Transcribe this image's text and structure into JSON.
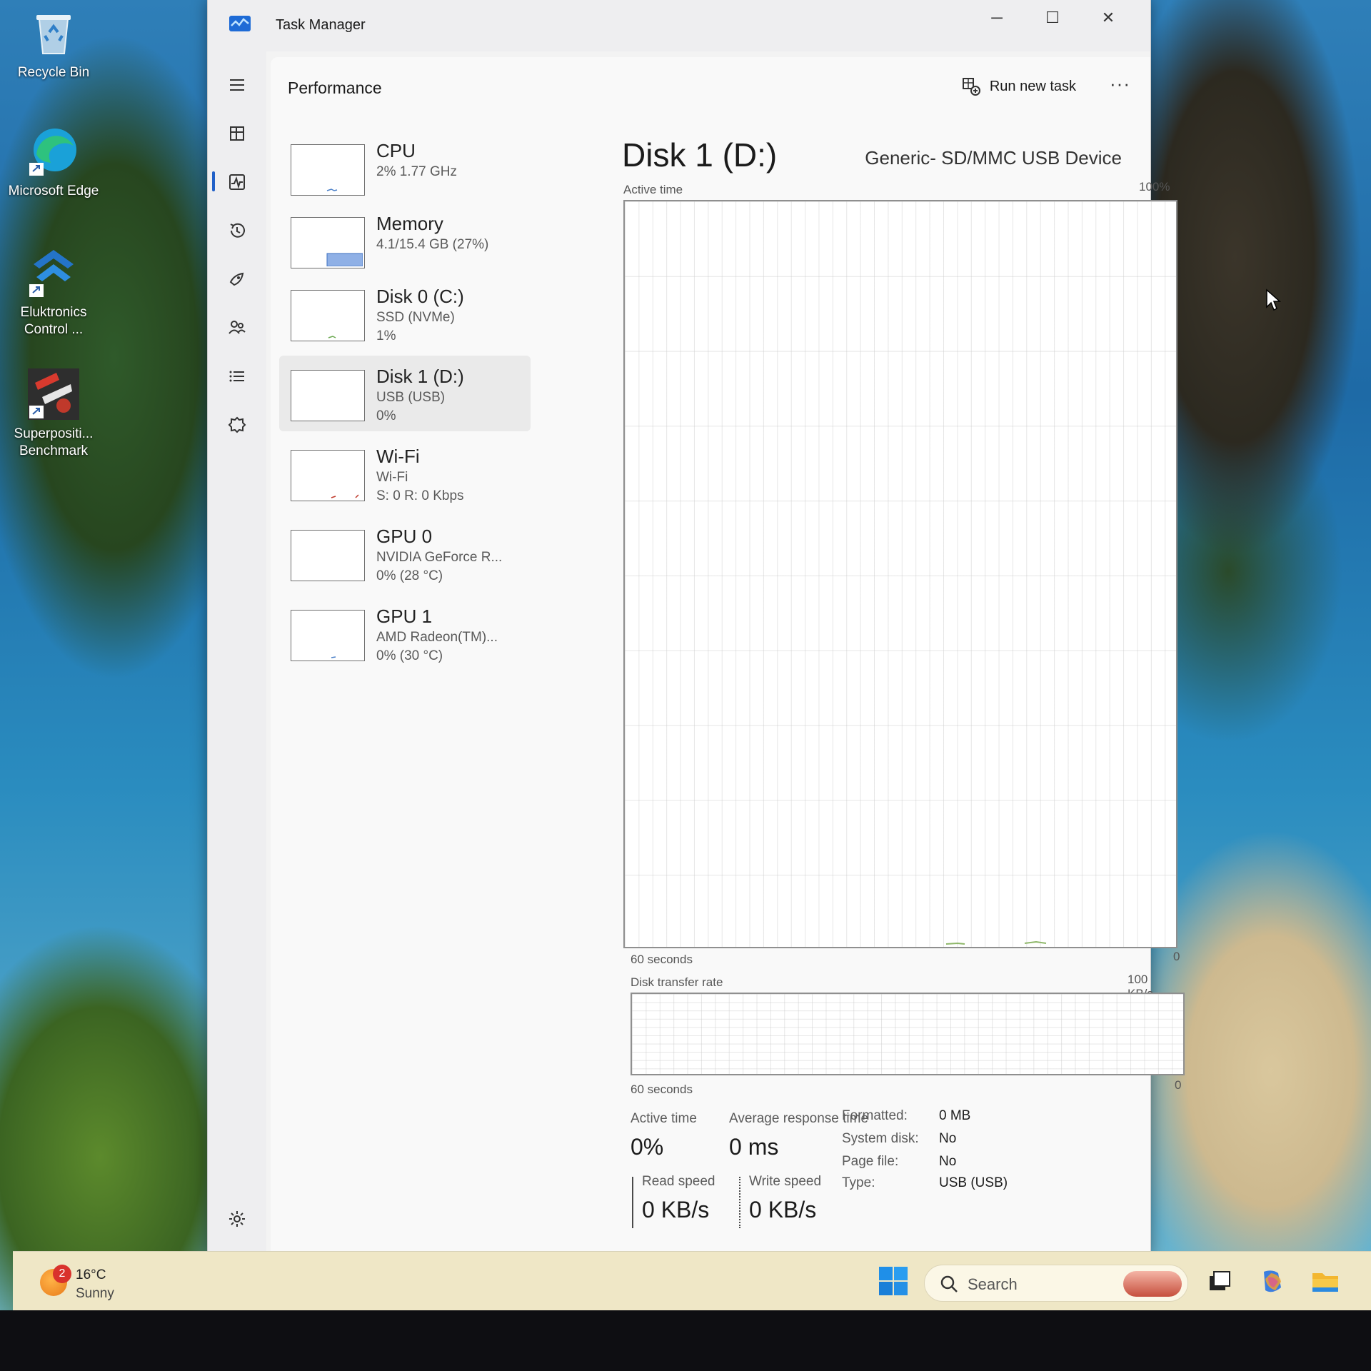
{
  "desktop": {
    "icons": [
      {
        "label": "Recycle Bin",
        "icon": "recycle-bin-icon"
      },
      {
        "label": "Microsoft Edge",
        "icon": "edge-icon"
      },
      {
        "label": "Eluktronics Control ...",
        "icon": "eluktronics-icon"
      },
      {
        "label": "Superpositi... Benchmark",
        "icon": "superposition-icon"
      }
    ]
  },
  "window": {
    "title": "Task Manager",
    "controls": {
      "minimize": "─",
      "maximize": "☐",
      "close": "✕"
    }
  },
  "nav": {
    "items": [
      {
        "name": "hamburger-menu",
        "icon": "menu-icon"
      },
      {
        "name": "processes",
        "icon": "processes-icon"
      },
      {
        "name": "performance",
        "icon": "performance-icon",
        "active": true
      },
      {
        "name": "app-history",
        "icon": "history-icon"
      },
      {
        "name": "startup-apps",
        "icon": "startup-icon"
      },
      {
        "name": "users",
        "icon": "users-icon"
      },
      {
        "name": "details",
        "icon": "details-icon"
      },
      {
        "name": "services",
        "icon": "services-icon"
      },
      {
        "name": "settings",
        "icon": "settings-icon"
      }
    ]
  },
  "header": {
    "title": "Performance",
    "run_new_task": "Run new task",
    "more": "···"
  },
  "devices": [
    {
      "name": "CPU",
      "sub1": "2%  1.77 GHz",
      "sub2": ""
    },
    {
      "name": "Memory",
      "sub1": "4.1/15.4 GB (27%)",
      "sub2": ""
    },
    {
      "name": "Disk 0 (C:)",
      "sub1": "SSD (NVMe)",
      "sub2": "1%"
    },
    {
      "name": "Disk 1 (D:)",
      "sub1": "USB (USB)",
      "sub2": "0%"
    },
    {
      "name": "Wi-Fi",
      "sub1": "Wi-Fi",
      "sub2": "S: 0  R: 0 Kbps"
    },
    {
      "name": "GPU 0",
      "sub1": "NVIDIA GeForce R...",
      "sub2": "0%  (28 °C)"
    },
    {
      "name": "GPU 1",
      "sub1": "AMD Radeon(TM)...",
      "sub2": "0%  (30 °C)"
    }
  ],
  "detail": {
    "title": "Disk 1 (D:)",
    "model": "Generic- SD/MMC USB Device",
    "active_graph": {
      "label": "Active time",
      "max": "100%",
      "x_label": "60 seconds",
      "min": "0"
    },
    "rate_graph": {
      "label": "Disk transfer rate",
      "max": "100 KB/s",
      "x_label": "60 seconds",
      "min": "0"
    },
    "stats": {
      "active_time_label": "Active time",
      "active_time_value": "0%",
      "avg_response_label": "Average response time",
      "avg_response_value": "0 ms",
      "read_speed_label": "Read speed",
      "read_speed_value": "0 KB/s",
      "write_speed_label": "Write speed",
      "write_speed_value": "0 KB/s"
    },
    "properties": [
      {
        "key": "Formatted:",
        "value": "0 MB"
      },
      {
        "key": "System disk:",
        "value": "No"
      },
      {
        "key": "Page file:",
        "value": "No"
      },
      {
        "key": "Type:",
        "value": "USB (USB)"
      }
    ]
  },
  "taskbar": {
    "weather": {
      "badge": "2",
      "temp": "16°C",
      "desc": "Sunny"
    },
    "search_placeholder": "Search",
    "apps": [
      "task-view-icon",
      "copilot-icon",
      "file-explorer-icon"
    ]
  }
}
